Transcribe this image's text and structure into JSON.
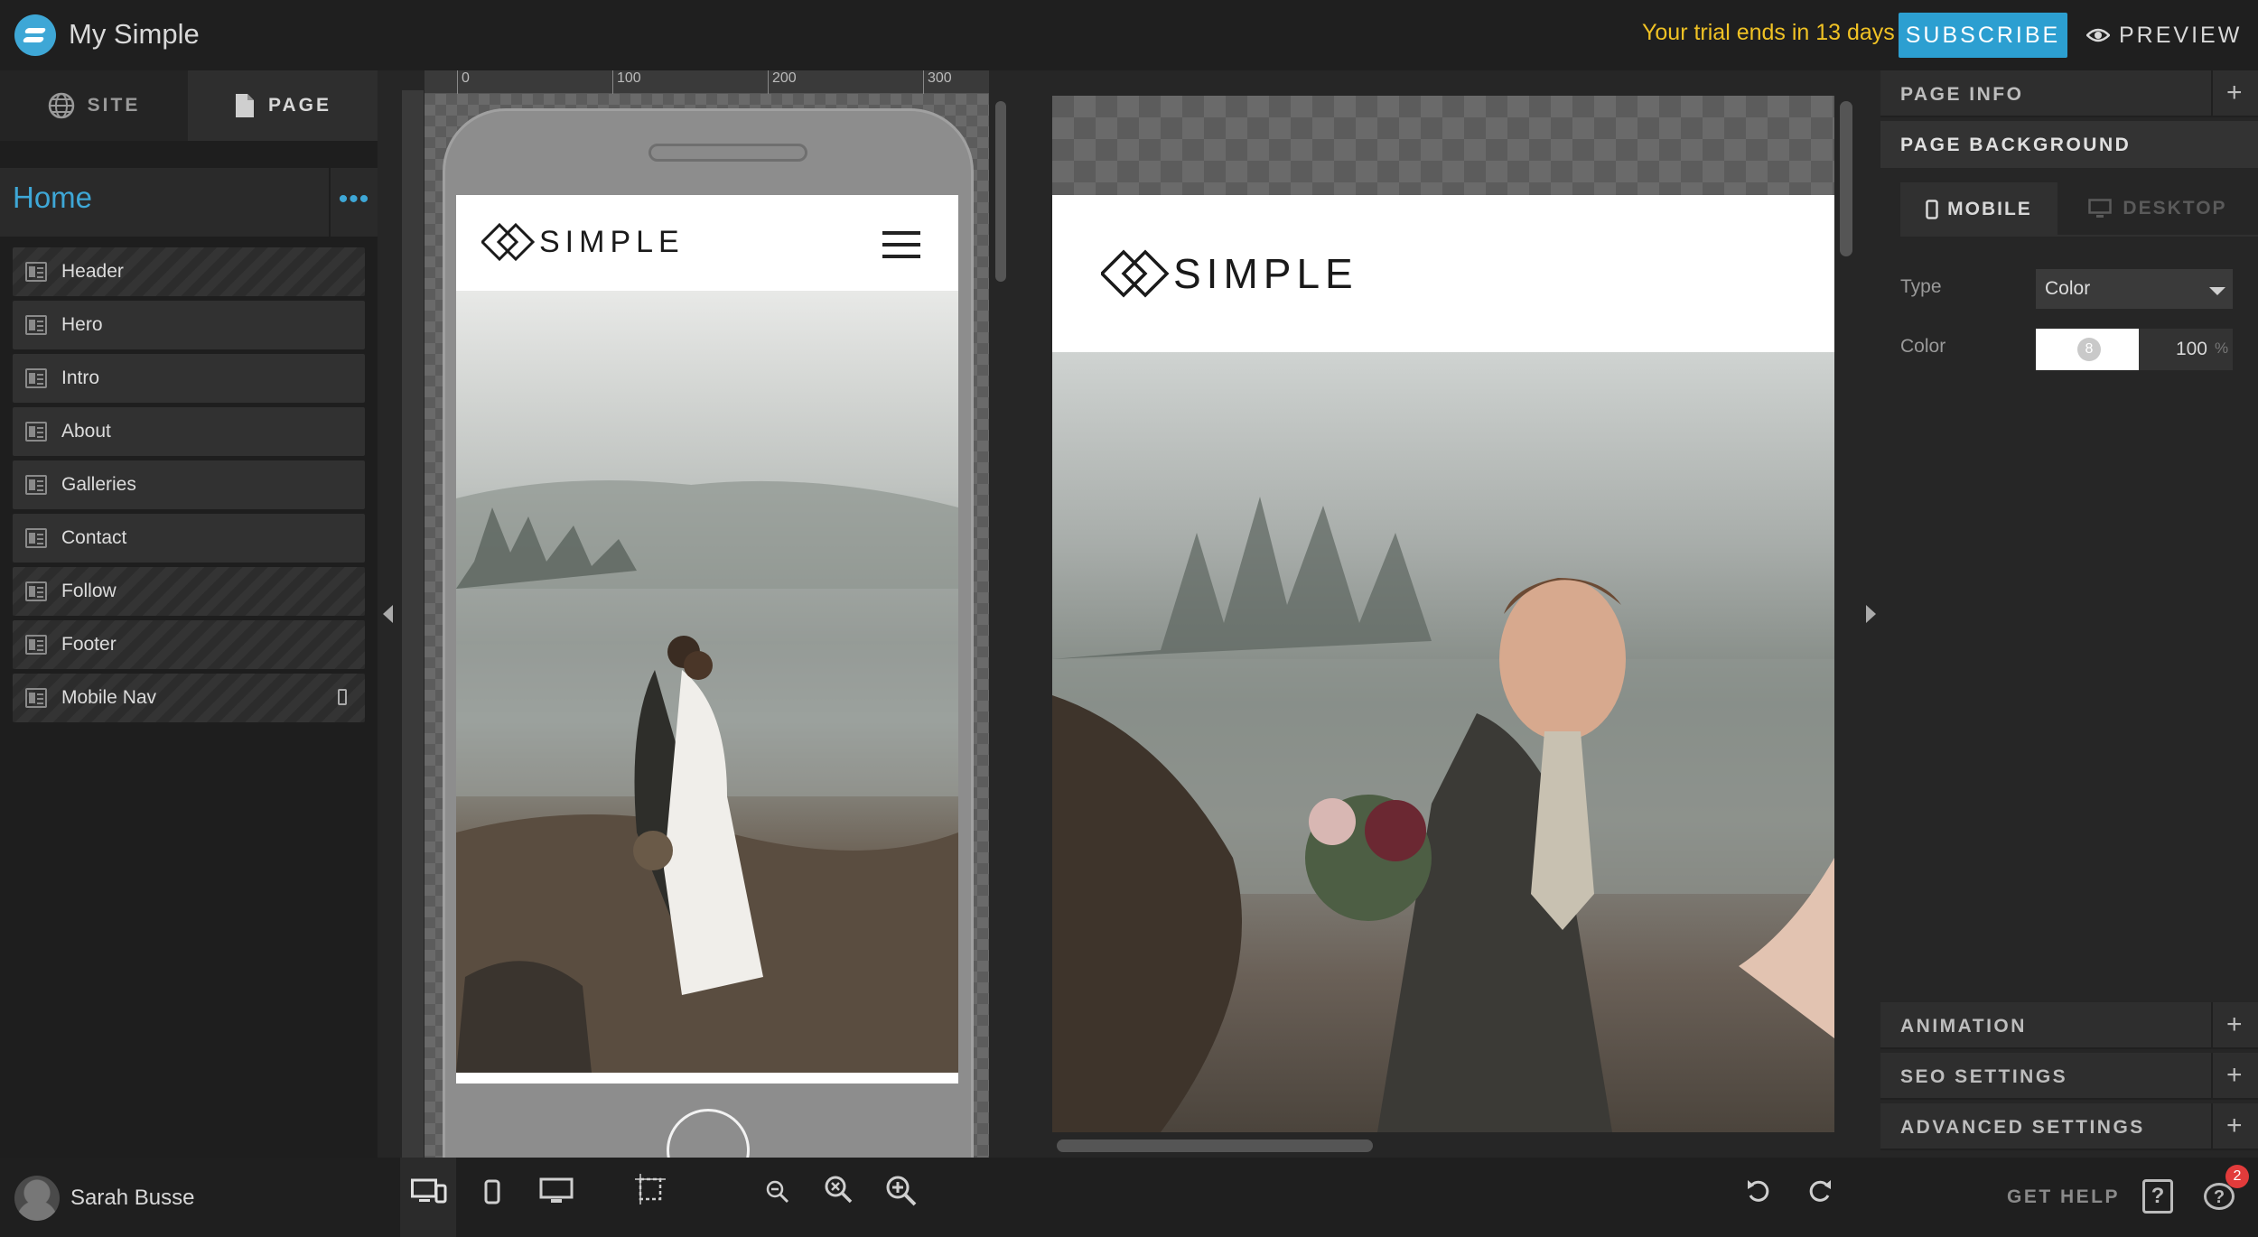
{
  "app": {
    "title": "My Simple",
    "trial_notice": "Your trial ends in 13 days",
    "subscribe_label": "SUBSCRIBE",
    "preview_label": "PREVIEW",
    "accent": "#2c9fd1",
    "trial_color": "#f0c224"
  },
  "left_panel": {
    "tabs": [
      {
        "label": "SITE",
        "icon": "globe-icon"
      },
      {
        "label": "PAGE",
        "icon": "page-icon",
        "active": true
      }
    ],
    "page_title": "Home",
    "sections": [
      {
        "label": "Header",
        "striped": true
      },
      {
        "label": "Hero"
      },
      {
        "label": "Intro"
      },
      {
        "label": "About"
      },
      {
        "label": "Galleries"
      },
      {
        "label": "Contact"
      },
      {
        "label": "Follow",
        "striped": true
      },
      {
        "label": "Footer",
        "striped": true
      },
      {
        "label": "Mobile Nav",
        "striped": true,
        "icon": "mobile-icon"
      }
    ]
  },
  "ruler": {
    "ticks": [
      "0",
      "100",
      "200",
      "300"
    ]
  },
  "site_preview": {
    "logo_text": "SIMPLE"
  },
  "right_panel": {
    "page_info": "PAGE INFO",
    "page_background": "PAGE BACKGROUND",
    "tab_mobile": "MOBILE",
    "tab_desktop": "DESKTOP",
    "type_label": "Type",
    "type_value": "Color",
    "color_label": "Color",
    "swatch_color": "#ffffff",
    "swatch_glyph": "8",
    "opacity_value": "100",
    "opacity_unit": "%",
    "animation": "ANIMATION",
    "seo_settings": "SEO SETTINGS",
    "advanced_settings": "ADVANCED SETTINGS"
  },
  "bottom_bar": {
    "user_name": "Sarah Busse",
    "get_help": "GET HELP",
    "help_glyph": "?",
    "chat_glyph": "?",
    "notification_count": "2"
  }
}
